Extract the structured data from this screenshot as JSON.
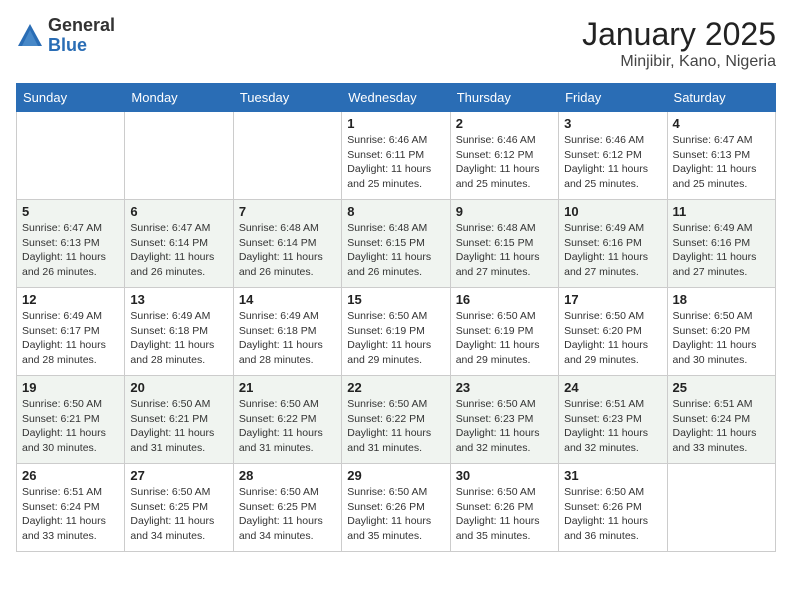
{
  "logo": {
    "general": "General",
    "blue": "Blue"
  },
  "title": "January 2025",
  "location": "Minjibir, Kano, Nigeria",
  "days_of_week": [
    "Sunday",
    "Monday",
    "Tuesday",
    "Wednesday",
    "Thursday",
    "Friday",
    "Saturday"
  ],
  "weeks": [
    [
      {
        "day": "",
        "info": ""
      },
      {
        "day": "",
        "info": ""
      },
      {
        "day": "",
        "info": ""
      },
      {
        "day": "1",
        "info": "Sunrise: 6:46 AM\nSunset: 6:11 PM\nDaylight: 11 hours and 25 minutes."
      },
      {
        "day": "2",
        "info": "Sunrise: 6:46 AM\nSunset: 6:12 PM\nDaylight: 11 hours and 25 minutes."
      },
      {
        "day": "3",
        "info": "Sunrise: 6:46 AM\nSunset: 6:12 PM\nDaylight: 11 hours and 25 minutes."
      },
      {
        "day": "4",
        "info": "Sunrise: 6:47 AM\nSunset: 6:13 PM\nDaylight: 11 hours and 25 minutes."
      }
    ],
    [
      {
        "day": "5",
        "info": "Sunrise: 6:47 AM\nSunset: 6:13 PM\nDaylight: 11 hours and 26 minutes."
      },
      {
        "day": "6",
        "info": "Sunrise: 6:47 AM\nSunset: 6:14 PM\nDaylight: 11 hours and 26 minutes."
      },
      {
        "day": "7",
        "info": "Sunrise: 6:48 AM\nSunset: 6:14 PM\nDaylight: 11 hours and 26 minutes."
      },
      {
        "day": "8",
        "info": "Sunrise: 6:48 AM\nSunset: 6:15 PM\nDaylight: 11 hours and 26 minutes."
      },
      {
        "day": "9",
        "info": "Sunrise: 6:48 AM\nSunset: 6:15 PM\nDaylight: 11 hours and 27 minutes."
      },
      {
        "day": "10",
        "info": "Sunrise: 6:49 AM\nSunset: 6:16 PM\nDaylight: 11 hours and 27 minutes."
      },
      {
        "day": "11",
        "info": "Sunrise: 6:49 AM\nSunset: 6:16 PM\nDaylight: 11 hours and 27 minutes."
      }
    ],
    [
      {
        "day": "12",
        "info": "Sunrise: 6:49 AM\nSunset: 6:17 PM\nDaylight: 11 hours and 28 minutes."
      },
      {
        "day": "13",
        "info": "Sunrise: 6:49 AM\nSunset: 6:18 PM\nDaylight: 11 hours and 28 minutes."
      },
      {
        "day": "14",
        "info": "Sunrise: 6:49 AM\nSunset: 6:18 PM\nDaylight: 11 hours and 28 minutes."
      },
      {
        "day": "15",
        "info": "Sunrise: 6:50 AM\nSunset: 6:19 PM\nDaylight: 11 hours and 29 minutes."
      },
      {
        "day": "16",
        "info": "Sunrise: 6:50 AM\nSunset: 6:19 PM\nDaylight: 11 hours and 29 minutes."
      },
      {
        "day": "17",
        "info": "Sunrise: 6:50 AM\nSunset: 6:20 PM\nDaylight: 11 hours and 29 minutes."
      },
      {
        "day": "18",
        "info": "Sunrise: 6:50 AM\nSunset: 6:20 PM\nDaylight: 11 hours and 30 minutes."
      }
    ],
    [
      {
        "day": "19",
        "info": "Sunrise: 6:50 AM\nSunset: 6:21 PM\nDaylight: 11 hours and 30 minutes."
      },
      {
        "day": "20",
        "info": "Sunrise: 6:50 AM\nSunset: 6:21 PM\nDaylight: 11 hours and 31 minutes."
      },
      {
        "day": "21",
        "info": "Sunrise: 6:50 AM\nSunset: 6:22 PM\nDaylight: 11 hours and 31 minutes."
      },
      {
        "day": "22",
        "info": "Sunrise: 6:50 AM\nSunset: 6:22 PM\nDaylight: 11 hours and 31 minutes."
      },
      {
        "day": "23",
        "info": "Sunrise: 6:50 AM\nSunset: 6:23 PM\nDaylight: 11 hours and 32 minutes."
      },
      {
        "day": "24",
        "info": "Sunrise: 6:51 AM\nSunset: 6:23 PM\nDaylight: 11 hours and 32 minutes."
      },
      {
        "day": "25",
        "info": "Sunrise: 6:51 AM\nSunset: 6:24 PM\nDaylight: 11 hours and 33 minutes."
      }
    ],
    [
      {
        "day": "26",
        "info": "Sunrise: 6:51 AM\nSunset: 6:24 PM\nDaylight: 11 hours and 33 minutes."
      },
      {
        "day": "27",
        "info": "Sunrise: 6:50 AM\nSunset: 6:25 PM\nDaylight: 11 hours and 34 minutes."
      },
      {
        "day": "28",
        "info": "Sunrise: 6:50 AM\nSunset: 6:25 PM\nDaylight: 11 hours and 34 minutes."
      },
      {
        "day": "29",
        "info": "Sunrise: 6:50 AM\nSunset: 6:26 PM\nDaylight: 11 hours and 35 minutes."
      },
      {
        "day": "30",
        "info": "Sunrise: 6:50 AM\nSunset: 6:26 PM\nDaylight: 11 hours and 35 minutes."
      },
      {
        "day": "31",
        "info": "Sunrise: 6:50 AM\nSunset: 6:26 PM\nDaylight: 11 hours and 36 minutes."
      },
      {
        "day": "",
        "info": ""
      }
    ]
  ]
}
